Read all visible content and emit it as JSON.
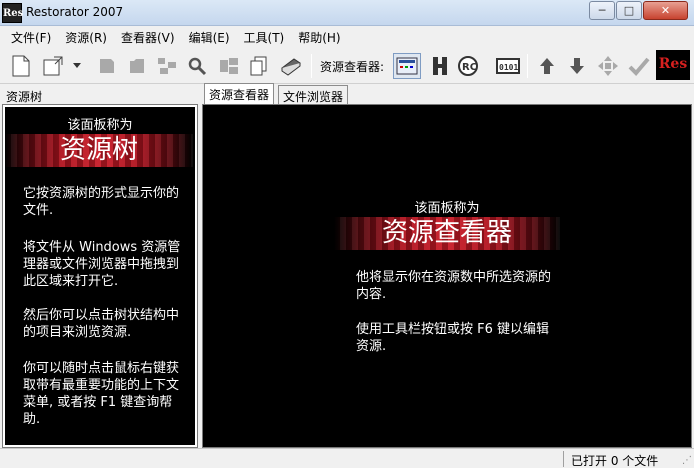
{
  "window": {
    "icon_text": "Res",
    "title": "Restorator 2007",
    "minimize_glyph": "─",
    "maximize_glyph": "□",
    "close_glyph": "✕"
  },
  "menu": [
    {
      "label": "文件(F)"
    },
    {
      "label": "资源(R)"
    },
    {
      "label": "查看器(V)"
    },
    {
      "label": "编辑(E)"
    },
    {
      "label": "工具(T)"
    },
    {
      "label": "帮助(H)"
    }
  ],
  "toolbar": {
    "viewer_label": "资源查看器:",
    "logo_text": "Res"
  },
  "left_panel": {
    "caption": "资源树",
    "heading_small": "该面板称为",
    "heading_big": "资源树",
    "paragraphs": [
      "它按资源树的形式显示你的文件.",
      "将文件从 Windows 资源管理器或文件浏览器中拖拽到此区域来打开它.",
      "然后你可以点击树状结构中的项目来浏览资源.",
      "你可以随时点击鼠标右键获取带有最重要功能的上下文菜单, 或者按 F1 键查询帮助."
    ]
  },
  "tabs": [
    {
      "label": "资源查看器"
    },
    {
      "label": "文件浏览器"
    }
  ],
  "right_panel": {
    "heading_small": "该面板称为",
    "heading_big": "资源查看器",
    "paragraphs": [
      "他将显示你在资源数中所选资源的内容.",
      "使用工具栏按钮或按 F6 键以编辑资源."
    ]
  },
  "status": {
    "files_open": "已打开 0 个文件"
  }
}
